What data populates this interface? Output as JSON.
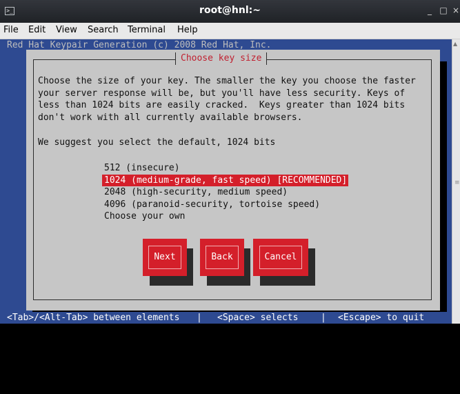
{
  "window": {
    "title": "root@hnl:~",
    "icon": "terminal-icon",
    "controls": [
      "_",
      "□",
      "×"
    ]
  },
  "menu": {
    "items": [
      "File",
      "Edit",
      "View",
      "Search",
      "Terminal",
      "Help"
    ]
  },
  "terminal": {
    "header": "Red Hat Keypair Generation (c) 2008 Red Hat, Inc.",
    "background": "#2e4a91"
  },
  "dialog": {
    "title": "Choose key size",
    "description": "Choose the size of your key. The smaller the key you choose the faster\nyour server response will be, but you'll have less security. Keys of\nless than 1024 bits are easily cracked.  Keys greater than 1024 bits\ndon't work with all currently available browsers.",
    "suggestion": "We suggest you select the default, 1024 bits",
    "options": [
      "512 (insecure)",
      "1024 (medium-grade, fast speed) [RECOMMENDED]",
      "2048 (high-security, medium speed)",
      "4096 (paranoid-security, tortoise speed)",
      "Choose your own"
    ],
    "selected_index": 1,
    "buttons": {
      "next": "Next",
      "back": "Back",
      "cancel": "Cancel"
    },
    "accent_color": "#d41f2a"
  },
  "status": {
    "tab_hint": "<Tab>/<Alt-Tab> between elements",
    "space_hint": "<Space> selects",
    "escape_hint": "<Escape> to quit",
    "separator": "|"
  }
}
